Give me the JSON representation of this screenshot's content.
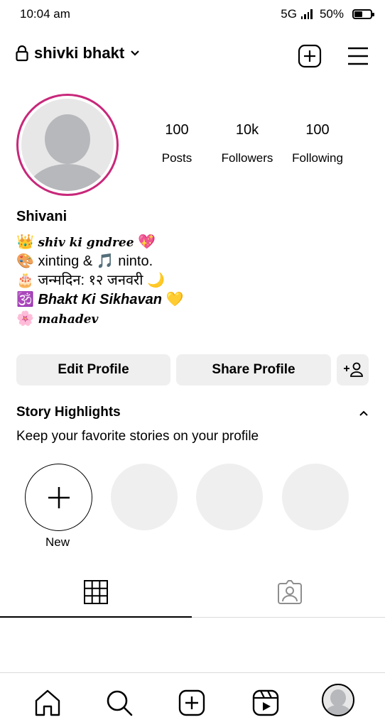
{
  "status": {
    "time": "10:04 am",
    "network": "5G",
    "battery": "50%"
  },
  "header": {
    "username": "shivki bhakt"
  },
  "profile": {
    "posts": "100",
    "posts_label": "Posts",
    "followers": "10k",
    "followers_label": "Followers",
    "following": "100",
    "following_label": "Following",
    "name": "Shivani",
    "bio": [
      {
        "emoji": "👑",
        "text": "shiv ki gndree",
        "end": "💖"
      },
      {
        "emoji": "🎨",
        "text": "xinting & 🎵 ninto.",
        "end": ""
      },
      {
        "emoji": "🎂",
        "text": "जन्मदिन: १२ जनवरी",
        "end": "🌙"
      },
      {
        "emoji": "🕉️",
        "text": "Bhakt Ki Sikhavan",
        "end": "💛"
      },
      {
        "emoji": "🌸",
        "text": "mahadev",
        "end": ""
      }
    ]
  },
  "buttons": {
    "edit": "Edit Profile",
    "share": "Share Profile"
  },
  "highlights": {
    "title": "Story Highlights",
    "subtitle": "Keep your favorite stories on your profile",
    "new_label": "New"
  },
  "colors": {
    "ring": "#c8287a",
    "button_bg": "#efefef",
    "placeholder": "#efefef"
  }
}
